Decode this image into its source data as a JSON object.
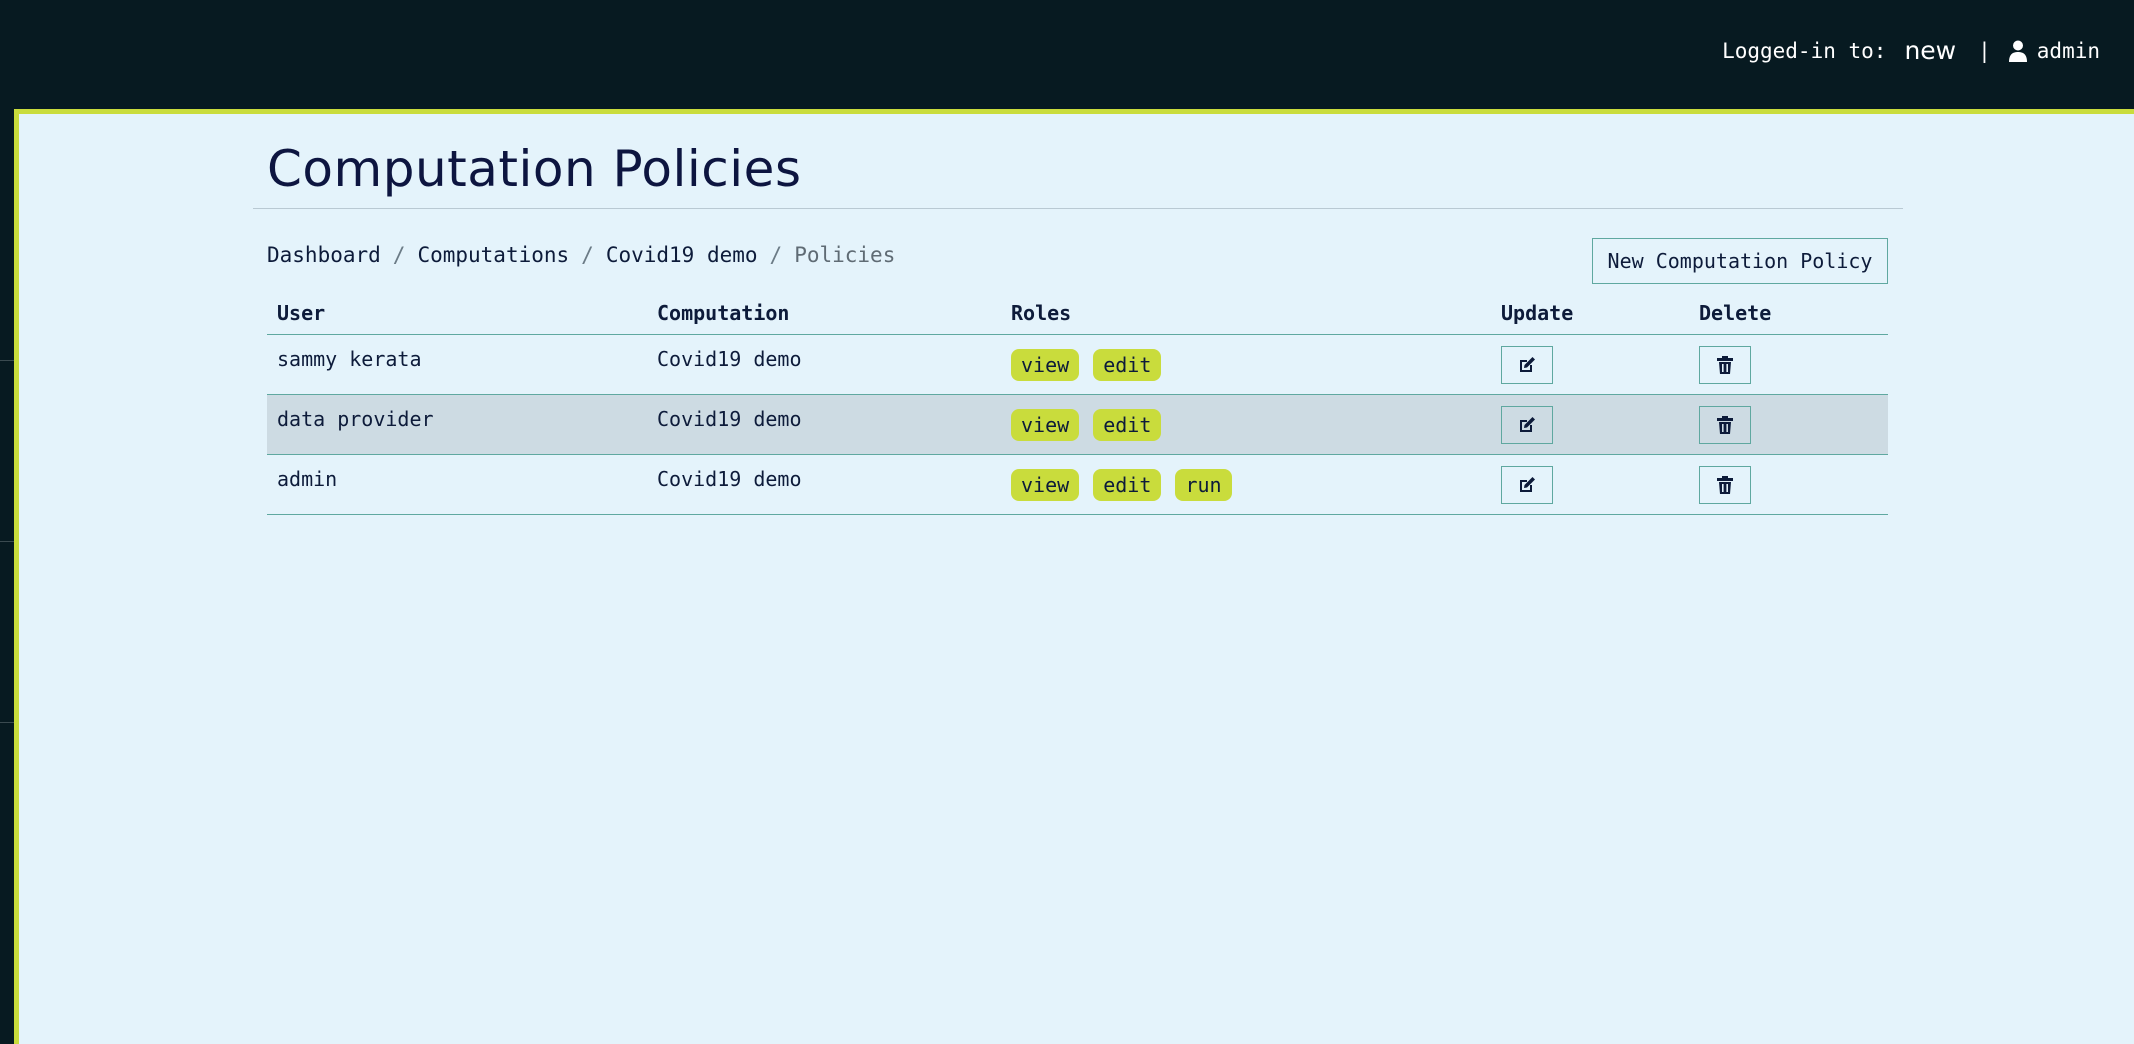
{
  "header": {
    "logged_in_label": "Logged-in to:",
    "realm": "new",
    "separator": "|",
    "username": "admin",
    "user_icon": "user-icon"
  },
  "page": {
    "title": "Computation Policies"
  },
  "breadcrumb": {
    "items": [
      "Dashboard",
      "Computations",
      "Covid19 demo"
    ],
    "current": "Policies",
    "separator": "/"
  },
  "toolbar": {
    "new_label": "New Computation Policy"
  },
  "table": {
    "headers": [
      "User",
      "Computation",
      "Roles",
      "Update",
      "Delete"
    ],
    "rows": [
      {
        "user": "sammy kerata",
        "computation": "Covid19 demo",
        "roles": [
          "view",
          "edit"
        ]
      },
      {
        "user": "data provider",
        "computation": "Covid19 demo",
        "roles": [
          "view",
          "edit"
        ]
      },
      {
        "user": "admin",
        "computation": "Covid19 demo",
        "roles": [
          "view",
          "edit",
          "run"
        ]
      }
    ],
    "update_icon": "edit-icon",
    "delete_icon": "trash-icon"
  },
  "colors": {
    "topbar": "#071a21",
    "accent": "#c9dc3c",
    "background": "#e4f3fb",
    "border": "#5fa8a0",
    "row_alt": "#cddbe3"
  }
}
